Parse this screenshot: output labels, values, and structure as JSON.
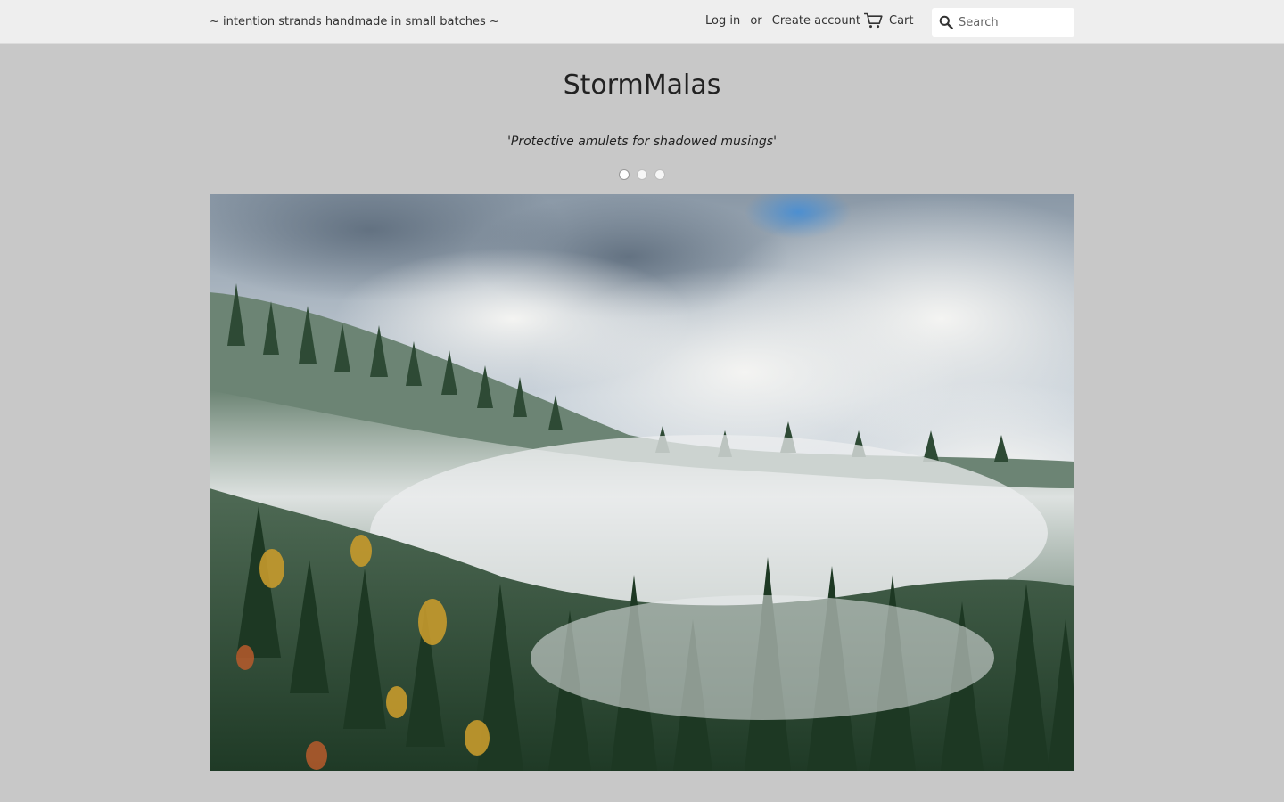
{
  "announcement": "~ intention strands handmade in small batches ~",
  "account": {
    "login_label": "Log in",
    "separator": "or",
    "create_label": "Create account"
  },
  "cart": {
    "label": "Cart",
    "icon": "cart-icon"
  },
  "search": {
    "placeholder": "Search",
    "icon": "search-icon"
  },
  "header": {
    "title": "StormMalas",
    "tagline": "'Protective amulets for shadowed musings'"
  },
  "slideshow": {
    "slide_count": 3,
    "active_index": 0
  },
  "colors": {
    "background": "#c8c8c8",
    "topbar": "#eeeeee",
    "text": "#333333"
  }
}
